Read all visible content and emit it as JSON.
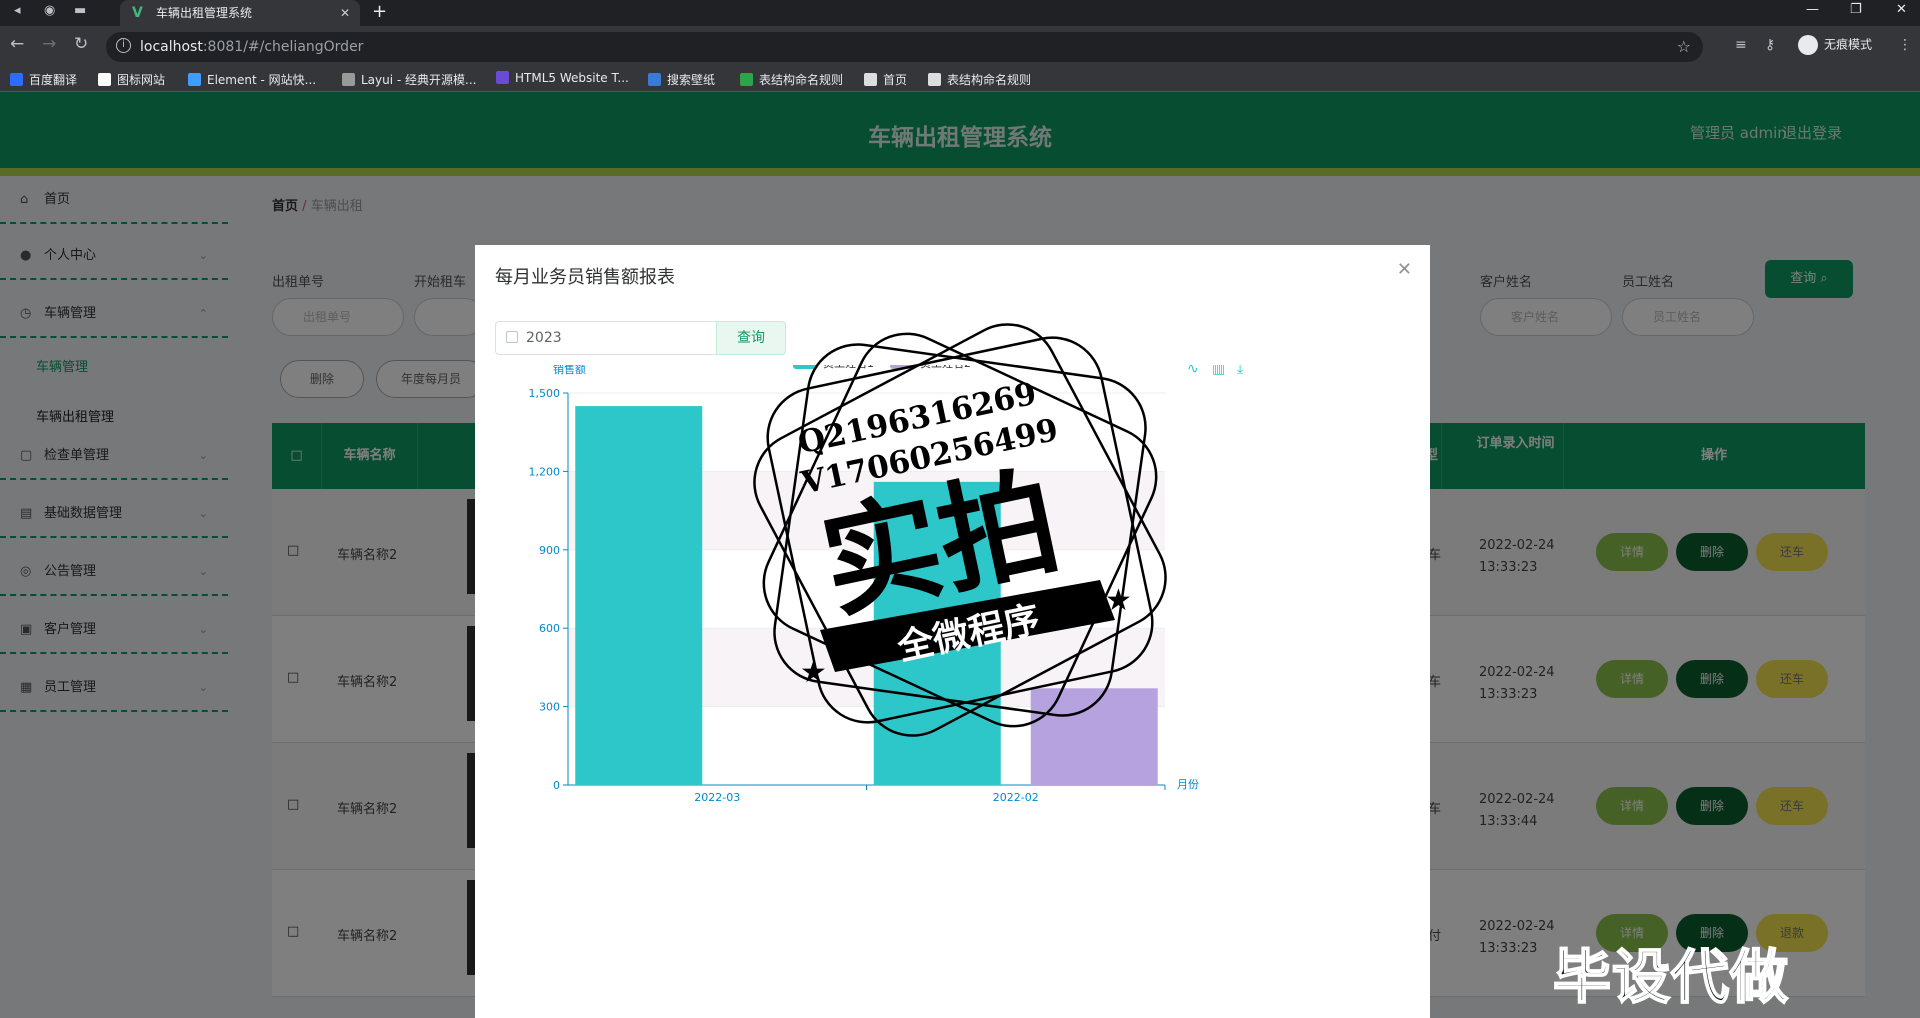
{
  "browser": {
    "tab_title": "车辆出租管理系统",
    "url_host": "localhost",
    "url_rest": ":8081/#/cheliangOrder",
    "incognito_label": "无痕模式",
    "bookmarks": [
      {
        "label": "百度翻译",
        "color": "#2f6bff"
      },
      {
        "label": "图标网站",
        "color": "#ffffff"
      },
      {
        "label": "Element - 网站快...",
        "color": "#409eff"
      },
      {
        "label": "Layui - 经典开源模...",
        "color": "#999999"
      },
      {
        "label": "HTML5 Website T...",
        "color": "#6a4bd6"
      },
      {
        "label": "搜索壁纸",
        "color": "#3a7bd5"
      },
      {
        "label": "表结构命名规则",
        "color": "#2ca44a"
      },
      {
        "label": "首页",
        "color": "#dddddd"
      },
      {
        "label": "表结构命名规则",
        "color": "#dddddd"
      }
    ]
  },
  "header": {
    "title": "车辆出租管理系统",
    "admin": "管理员 admin",
    "logout": "退出登录"
  },
  "sidebar": {
    "items": [
      {
        "label": "首页",
        "icon": "home-icon"
      },
      {
        "label": "个人中心",
        "icon": "user-icon"
      },
      {
        "label": "车辆管理",
        "icon": "car-icon"
      },
      {
        "label": "检查单管理",
        "icon": "doc-icon"
      },
      {
        "label": "基础数据管理",
        "icon": "db-icon"
      },
      {
        "label": "公告管理",
        "icon": "notice-icon"
      },
      {
        "label": "客户管理",
        "icon": "customer-icon"
      },
      {
        "label": "员工管理",
        "icon": "staff-icon"
      }
    ],
    "subitems": [
      "车辆管理",
      "车辆出租管理"
    ]
  },
  "breadcrumb": {
    "home": "首页",
    "sep": "/",
    "current": "车辆出租"
  },
  "filters": {
    "order_no_label": "出租单号",
    "order_no_ph": "出租单号",
    "start_label": "开始租车",
    "customer_label": "客户姓名",
    "customer_ph": "客户姓名",
    "staff_label": "员工姓名",
    "staff_ph": "员工姓名",
    "query": "查询 ⌕"
  },
  "ops": {
    "delete": "删除",
    "report": "年度每月员"
  },
  "table": {
    "headers": {
      "name": "车辆名称",
      "type": "型",
      "time": "订单录入时间",
      "op": "操作"
    },
    "rows": [
      {
        "name": "车辆名称2",
        "type": "车",
        "time": "2022-02-24 13:33:23",
        "a1": "详情",
        "a2": "删除",
        "a3": "还车"
      },
      {
        "name": "车辆名称2",
        "type": "车",
        "time": "2022-02-24 13:33:23",
        "a1": "详情",
        "a2": "删除",
        "a3": "还车"
      },
      {
        "name": "车辆名称2",
        "type": "车",
        "time": "2022-02-24 13:33:44",
        "a1": "详情",
        "a2": "删除",
        "a3": "还车"
      },
      {
        "name": "车辆名称2",
        "type": "付",
        "time": "2022-02-24 13:33:23",
        "a1": "详情",
        "a2": "删除",
        "a3": "退款"
      }
    ]
  },
  "dialog": {
    "title": "每月业务员销售额报表",
    "year": "2023",
    "query": "查询"
  },
  "chart_data": {
    "type": "bar",
    "categories": [
      "2022-03",
      "2022-02"
    ],
    "series": [
      {
        "name": "员工姓名1",
        "values": [
          1450,
          1160
        ],
        "color": "#2ec7c9"
      },
      {
        "name": "员工姓名2",
        "values": [
          0,
          370
        ],
        "color": "#b6a2de"
      }
    ],
    "xlabel": "月份",
    "ylabel": "销售额",
    "ylim": [
      0,
      1500
    ],
    "yticks": [
      0,
      300,
      600,
      900,
      1200,
      1500
    ],
    "ytick_labels": [
      "0",
      "300",
      "600",
      "900",
      "1,200",
      "1,500"
    ],
    "grid": true,
    "legend": "top"
  },
  "watermark": {
    "stamp_line1": "Q2196316269",
    "stamp_line2": "V17060256499",
    "stamp_big": "实拍",
    "stamp_ribbon": "全微程序",
    "bottom": "毕设代做"
  }
}
